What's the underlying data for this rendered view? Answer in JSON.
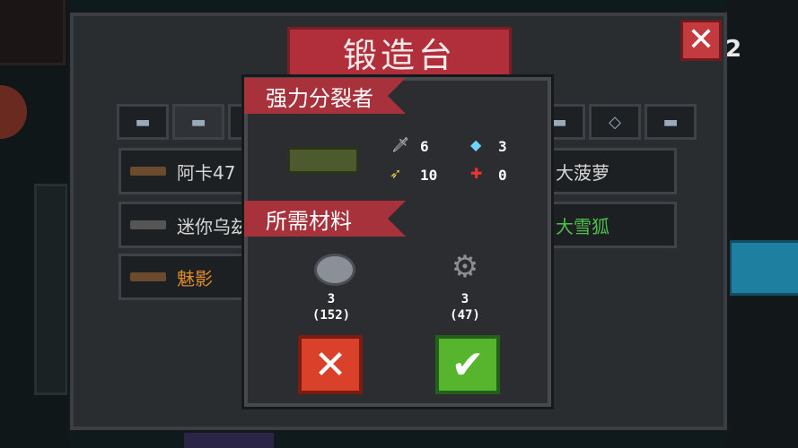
{
  "window": {
    "title": "锻造台",
    "close_label": "✕",
    "badge": "2"
  },
  "tabs_left": [
    {
      "icon": "pistol-icon"
    },
    {
      "icon": "rifle-icon"
    },
    {
      "icon": "smg-icon"
    }
  ],
  "tabs_right": [
    {
      "icon": "blaster-icon"
    },
    {
      "icon": "diamond-icon"
    },
    {
      "icon": "fish-gun-icon"
    }
  ],
  "weapon_list": [
    {
      "name": "阿卡47",
      "color": "#d6d6d6"
    },
    {
      "name": "迷你乌兹",
      "color": "#d6d6d6"
    },
    {
      "name": "魅影",
      "color": "#e08a2a"
    }
  ],
  "weapon_list_right": [
    {
      "name": "大菠萝",
      "color": "#d6d6d6"
    },
    {
      "name": "大雪狐",
      "color": "#4fbf4a"
    }
  ],
  "modal": {
    "weapon_name": "强力分裂者",
    "materials_label": "所需材料",
    "stats": {
      "damage": "6",
      "energy": "3",
      "crit": "10",
      "accuracy": "0"
    },
    "materials": [
      {
        "icon": "ore-icon",
        "needed": "3",
        "owned": "(152)"
      },
      {
        "icon": "gear-icon",
        "needed": "3",
        "owned": "(47)"
      }
    ],
    "cancel_label": "✕",
    "confirm_label": "✔"
  }
}
